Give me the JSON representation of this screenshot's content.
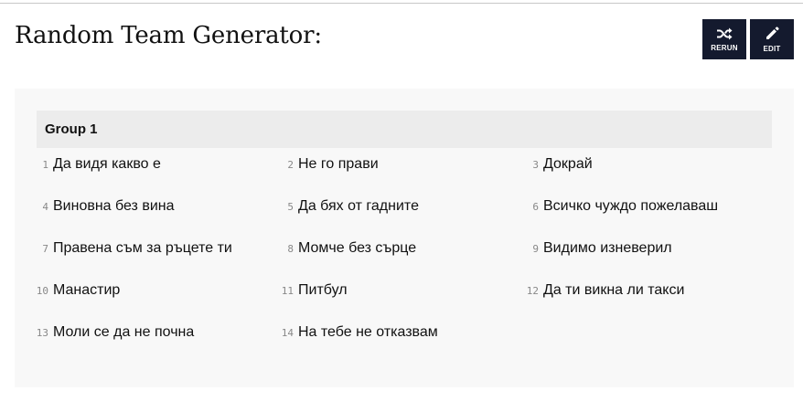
{
  "header": {
    "title": "Random Team Generator:"
  },
  "toolbar": {
    "rerun": {
      "label": "RERUN",
      "icon": "shuffle-icon"
    },
    "edit": {
      "label": "EDIT",
      "icon": "pencil-icon"
    }
  },
  "colors": {
    "button_bg": "#141a2e",
    "panel_bg": "#f8f8f8",
    "group_header_bg": "#ececec"
  },
  "group": {
    "title": "Group 1",
    "members": [
      {
        "num": "1",
        "name": "Да видя какво е"
      },
      {
        "num": "2",
        "name": "Не го прави"
      },
      {
        "num": "3",
        "name": "Докрай"
      },
      {
        "num": "4",
        "name": "Виновна без вина"
      },
      {
        "num": "5",
        "name": "Да бях от гадните"
      },
      {
        "num": "6",
        "name": "Всичко чуждо пожелаваш"
      },
      {
        "num": "7",
        "name": "Правена съм за ръцете ти"
      },
      {
        "num": "8",
        "name": "Момче без сърце"
      },
      {
        "num": "9",
        "name": "Видимо изневерил"
      },
      {
        "num": "10",
        "name": "Манастир"
      },
      {
        "num": "11",
        "name": "Питбул"
      },
      {
        "num": "12",
        "name": "Да ти викна ли такси"
      },
      {
        "num": "13",
        "name": "Моли се да не почна"
      },
      {
        "num": "14",
        "name": "На тебе не отказвам"
      }
    ]
  }
}
